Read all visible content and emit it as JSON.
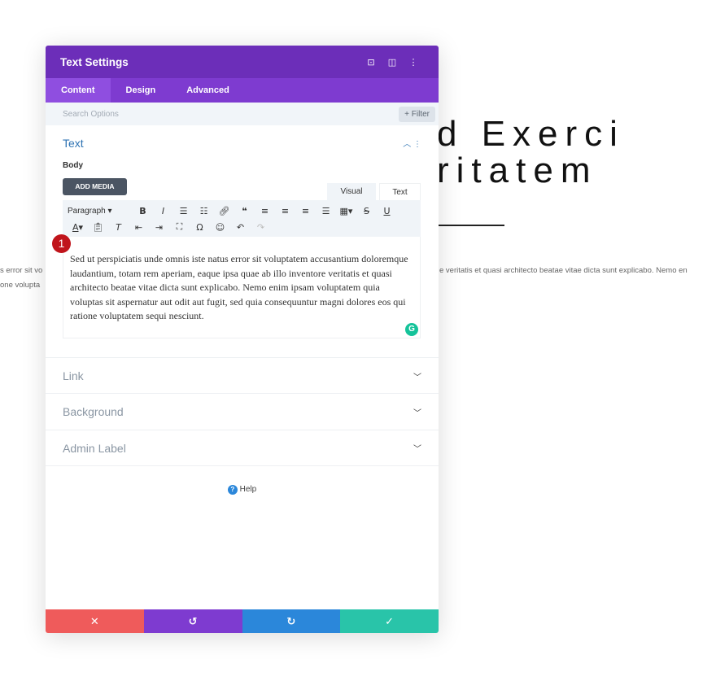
{
  "background": {
    "heading_line1": "d Exerci",
    "heading_line2": "ritatem",
    "para_left_1": "s error sit vo",
    "para_left_2": "one volupta",
    "para_right": "e veritatis et quasi architecto beatae vitae dicta sunt explicabo. Nemo en"
  },
  "modal": {
    "title": "Text Settings",
    "icons": [
      "focus-icon",
      "split-view-icon",
      "more-icon"
    ],
    "tabs": [
      {
        "label": "Content",
        "active": true
      },
      {
        "label": "Design"
      },
      {
        "label": "Advanced"
      }
    ],
    "search_placeholder": "Search Options",
    "filter_label": "+ Filter",
    "section_title": "Text",
    "body_label": "Body",
    "add_media": "ADD MEDIA",
    "visual_tab": "Visual",
    "text_tab": "Text",
    "format_select": "Paragraph",
    "badge": "1",
    "editor_text": "Sed ut perspiciatis unde omnis iste natus error sit voluptatem accusantium doloremque laudantium, totam rem aperiam, eaque ipsa quae ab illo inventore veritatis et quasi architecto beatae vitae dicta sunt explicabo. Nemo enim ipsam voluptatem quia voluptas sit aspernatur aut odit aut fugit, sed quia consequuntur magni dolores eos qui ratione voluptatem sequi nesciunt.",
    "grammarly": "G",
    "collapsed_sections": [
      "Link",
      "Background",
      "Admin Label"
    ],
    "help": "Help",
    "footer_colors": {
      "cancel": "#ef5b5b",
      "undo": "#7e3bd0",
      "redo": "#2b87da",
      "save": "#29c4a9"
    }
  }
}
